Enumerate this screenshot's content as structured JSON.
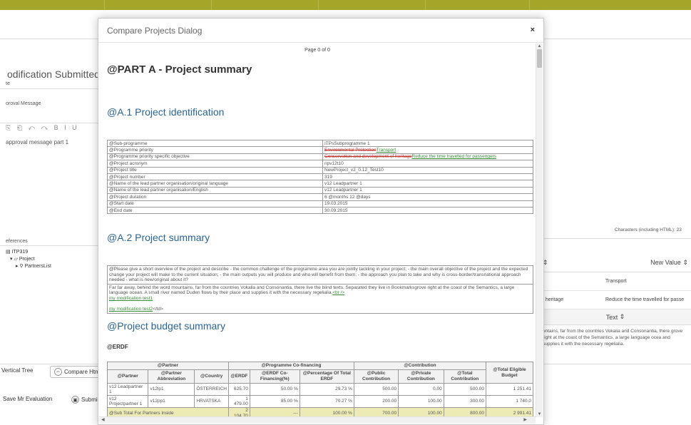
{
  "colors": {
    "topbar": "#a5a52a",
    "link_blue": "#2a6496",
    "deleted": "#c9302c",
    "inserted": "#3c8d3c",
    "subtotal_bg": "#ecebb6"
  },
  "background": {
    "title": "odification Submitted",
    "field_label": "te",
    "approval_label": "oroval Message",
    "approval_text": "approval message part 1",
    "references_label": "eferences",
    "tree": [
      "ITP319",
      "Project",
      "PartnersList"
    ],
    "characters_label": "Characters (including HTML): 23",
    "buttons": {
      "vertical_tree": "Vertical Tree",
      "compare_html": "Compare Html",
      "save_eval": "Save Mr Evaluation",
      "submit": "Submi"
    },
    "compare_table": {
      "new_value_header": "New Value",
      "rows": [
        {
          "old": "",
          "new": "Transport"
        },
        {
          "old": "f heritage",
          "new": "Reduce the time travelled for passe"
        }
      ],
      "text_header": "Text",
      "text_para": "untains, far from the countries Vokalia and Consonantia, there grove right at the coast of the Semantics, a large language ocea and supplies it with the necessary regelialia."
    }
  },
  "dialog": {
    "title": "Compare Projects Dialog",
    "close_label": "×",
    "page_label": "Page 0 of 0",
    "part_heading": "@PART A - Project summary",
    "ident_heading": "@A.1 Project identification",
    "ident_rows": [
      {
        "k": "@Sub-programme",
        "v": "ITPsSubprogramme 1"
      },
      {
        "k": "@Programme priority",
        "del": "Environmental Protection",
        "ins": "Transport"
      },
      {
        "k": "@Programme priority specific objective",
        "del": "Conservation and development of heritage",
        "ins": "Reduce the time travelled for passengers"
      },
      {
        "k": "@Project acronym",
        "v": "npv12t10"
      },
      {
        "k": "@Project title",
        "v": "NewProject_v2_0.12_Test10"
      },
      {
        "k": "@Project number",
        "v": "319"
      },
      {
        "k": "@Name of the lead partner organisation/original language",
        "v": "v12 Leadpartner 1"
      },
      {
        "k": "@Name of the lead partner organisation/English",
        "v": "v12 Leadpartner 1"
      },
      {
        "k": "@Project duration",
        "v": "6 @months 12 @days"
      },
      {
        "k": "@Start date",
        "v": "19.03.2015"
      },
      {
        "k": "@End date",
        "v": "30.09.2015"
      }
    ],
    "summary_heading": "@A.2 Project summary",
    "summary_question": "@Please give a short overview of the project and describe - the common challenge of the programme area you are jointly tackling in your project; - the main overall objective of the project and the expected change your project will make to the current situation; - the main outputs you will produce and who will benefit from them; - the approach you plan to take and why is cross-border/transnational approach needed - what is new/original about it?",
    "summary_answer": "Far far away, behind the word mountains, far from the countries Vokalia and Consonantia, there live the blind texts. Separated they live in Bookmarksgrove right at the coast of the Semantics, a large language ocean. A small river named Duden flows by their place and supplies it with the necessary regelialia.",
    "summary_br": "<br />",
    "summary_mod1": "my modification test1",
    "summary_mod2": "my modification test2",
    "summary_td": "</td>",
    "budget_heading": "@Project budget summary",
    "budget_sub": "@ERDF",
    "budget_group_headers": {
      "partner": "@Partner",
      "cofin": "@Programme Co-financing",
      "contrib": "@Contribution",
      "total": "@Total Eligible Budget"
    },
    "budget_headers": [
      "@Partner",
      "@Partner Abbreviation",
      "@Country",
      "@ERDF",
      "@ERDF Co-Financing(%)",
      "@Percentage Of Total ERDF",
      "@Public Contribution",
      "@Private Contribution",
      "@Total Contribution"
    ],
    "budget_rows": [
      [
        "v12 Leadpartner 1",
        "v12lp1",
        "ÖSTERREICH",
        "625.70",
        "50.00 %",
        "29.73 %",
        "500.00",
        "0.00",
        "500.00",
        "1 251.41"
      ],
      [
        "v12 Projectpartner 1",
        "v12pp1",
        "HRVATSKA",
        "1 479.00",
        "85.00 %",
        "70.27 %",
        "200.00",
        "100.00",
        "300.00",
        "1 740.0"
      ]
    ],
    "budget_subtotal": [
      "@Sub Total For Partners Inside",
      "",
      "",
      "2 104.70",
      "---",
      "100.00 %",
      "700.00",
      "100.00",
      "800.00",
      "2 991.41"
    ]
  }
}
